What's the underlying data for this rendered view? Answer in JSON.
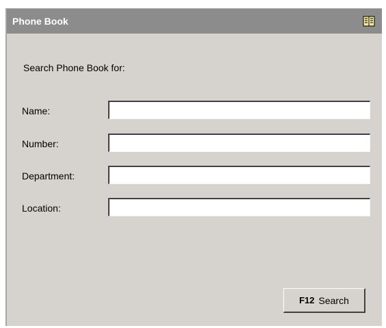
{
  "window": {
    "title": "Phone Book",
    "icon": "book-icon"
  },
  "form": {
    "heading": "Search Phone Book for:",
    "fields": [
      {
        "label": "Name:",
        "value": "",
        "placeholder": ""
      },
      {
        "label": "Number:",
        "value": "",
        "placeholder": ""
      },
      {
        "label": "Department:",
        "value": "",
        "placeholder": ""
      },
      {
        "label": "Location:",
        "value": "",
        "placeholder": ""
      }
    ]
  },
  "actions": {
    "search": {
      "key": "F12",
      "label": "Search"
    }
  },
  "colors": {
    "titlebar": "#8c8c8c",
    "panel": "#d6d3ce"
  }
}
